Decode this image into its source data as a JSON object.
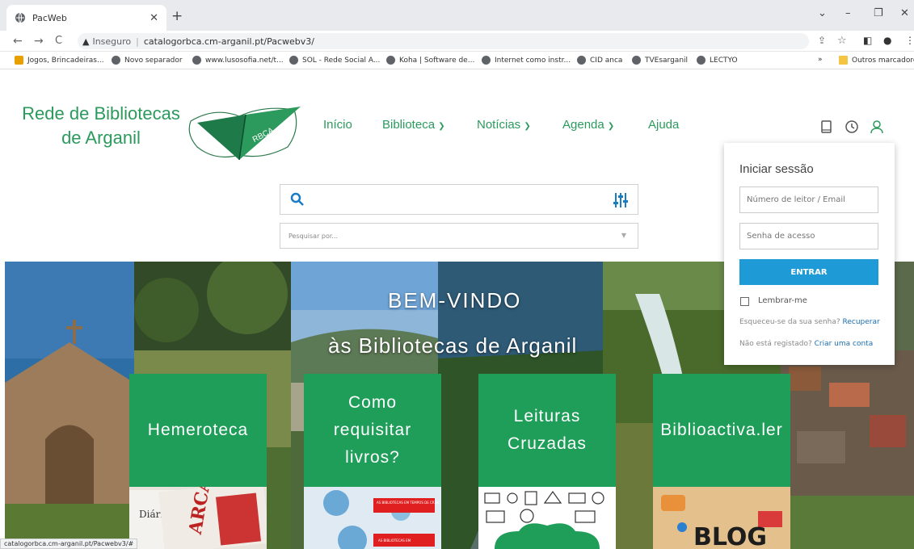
{
  "browser": {
    "tab_title": "PacWeb",
    "insecure_label": "Inseguro",
    "url": "catalogorbca.cm-arganil.pt/Pacwebv3/",
    "bookmarks": [
      "Jogos, Brincadeiras...",
      "Novo separador",
      "www.lusosofia.net/t...",
      "SOL - Rede Social A...",
      "Koha | Software de...",
      "Internet como instr...",
      "CID anca",
      "TVEsarganil",
      "LECTYO"
    ],
    "more_bookmarks": "»",
    "other_bookmarks": "Outros marcadores",
    "status_url": "catalogorbca.cm-arganil.pt/Pacwebv3/#"
  },
  "site": {
    "logo_line1": "Rede de Bibliotecas",
    "logo_line2": "de Arganil",
    "logo_badge": "RBCA",
    "nav": {
      "inicio": "Início",
      "biblioteca": "Biblioteca",
      "noticias": "Notícias",
      "agenda": "Agenda",
      "ajuda": "Ajuda"
    },
    "search_placeholder": "Pesquisar por...",
    "hero_title": "BEM-VINDO",
    "hero_subtitle": "às Bibliotecas de Arganil",
    "cards": {
      "c1": "Hemeroteca",
      "c2": "Como requisitar livros?",
      "c3": "Leituras Cruzadas",
      "c4": "Biblioactiva.ler"
    },
    "thumb_labels": {
      "newspaper1": "Diário",
      "newspaper2": "ARCA",
      "covid1": "AS BIBLIOTECAS EM TEMPOS DE CRISE",
      "covid2": "AS BIBLIOTECAS EM",
      "blog": "BLOG"
    }
  },
  "login": {
    "title": "Iniciar sessão",
    "user_placeholder": "Número de leitor / Email",
    "password_placeholder": "Senha de acesso",
    "submit": "ENTRAR",
    "remember": "Lembrar-me",
    "forgot_text": "Esqueceu-se da sua senha?",
    "forgot_link": "Recuperar",
    "register_text": "Não está registado?",
    "register_link": "Criar uma conta"
  },
  "colors": {
    "brand_green": "#1f9e5a",
    "nav_green": "#2b9a5c",
    "button_blue": "#1e9bd7"
  }
}
